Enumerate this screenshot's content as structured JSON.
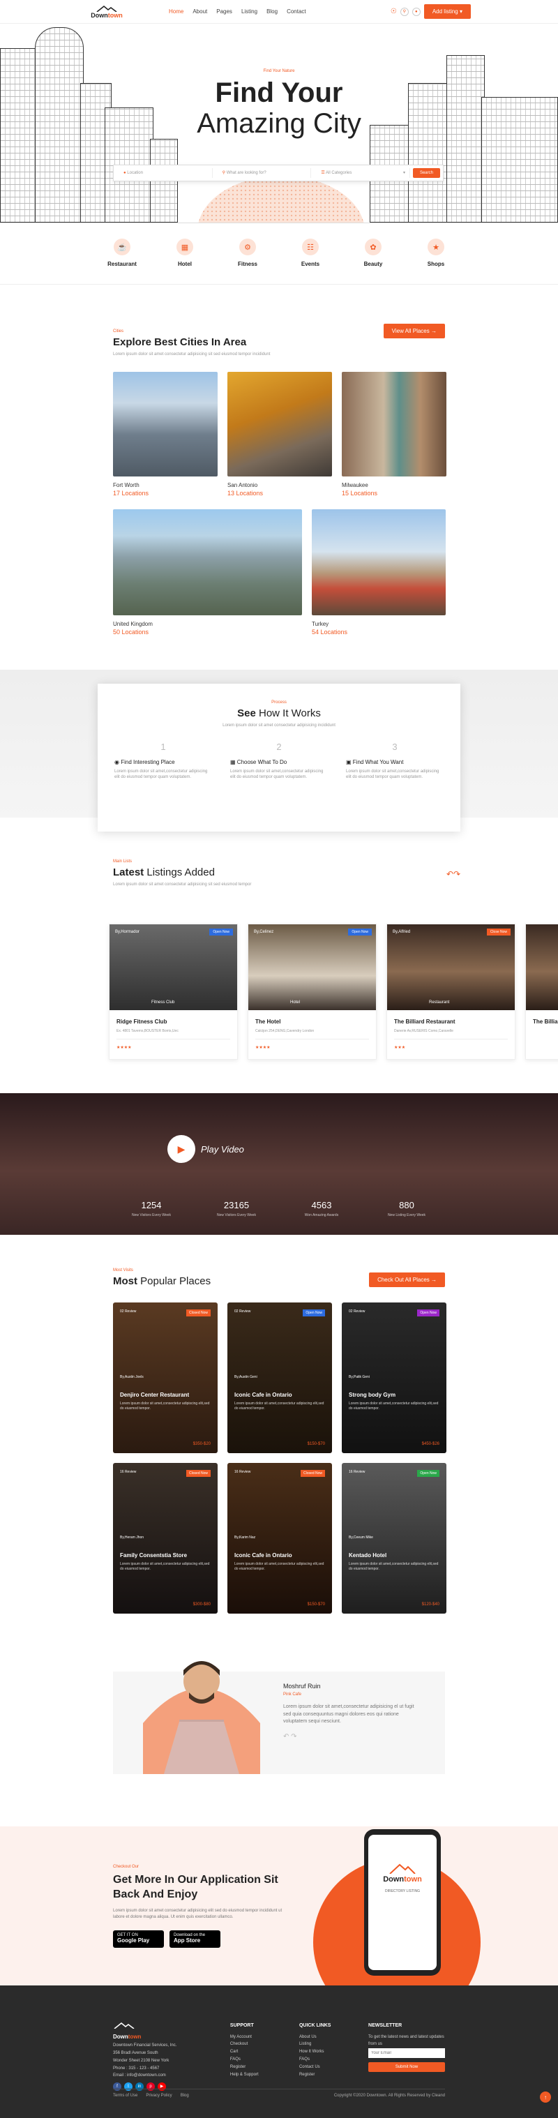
{
  "brand": {
    "name_a": "Down",
    "name_b": "town"
  },
  "nav": [
    "Home",
    "About",
    "Pages",
    "Listing",
    "Blog",
    "Contact"
  ],
  "header": {
    "add_listing": "Add listing"
  },
  "hero": {
    "sub": "Find Your Nature",
    "title": "Find Your",
    "title2": "Amazing City",
    "search": {
      "location": "Location",
      "what": "What are looking for?",
      "category": "All Categories",
      "btn": "Search"
    }
  },
  "categories": [
    "Restaurant",
    "Hotel",
    "Fitness",
    "Events",
    "Beauty",
    "Shops"
  ],
  "cities": {
    "sub": "Cities",
    "title": "Explore Best Cities In Area",
    "desc": "Lorem ipsum dolor sit amet consectetur adipisicing sit sed eiusmod tempor incididunt",
    "btn": "View All Places",
    "items": [
      {
        "name": "Fort Worth",
        "count": "17 Locations"
      },
      {
        "name": "San Antonio",
        "count": "13 Locations"
      },
      {
        "name": "Milwaukee",
        "count": "15 Locations"
      },
      {
        "name": "United Kingdom",
        "count": "50 Locations"
      },
      {
        "name": "Turkey",
        "count": "54 Locations"
      }
    ]
  },
  "how": {
    "sub": "Process",
    "title_b": "See",
    "title": "How It Works",
    "desc": "Lorem ipsum dolor sit amet consectetur adipisicing incididunt",
    "steps": [
      {
        "n": "1",
        "t": "Find Interesting Place",
        "d": "Lorem ipsum dolor sit amet,consectetur adipiscing elit do eiusmod tempor quam voluptatem."
      },
      {
        "n": "2",
        "t": "Choose What To Do",
        "d": "Lorem ipsum dolor sit amet,consectetur adipiscing elit do eiusmod tempor quam voluptatem."
      },
      {
        "n": "3",
        "t": "Find What You Want",
        "d": "Lorem ipsum dolor sit amet,consectetur adipiscing elit do eiusmod tempor quam voluptatem."
      }
    ]
  },
  "latest": {
    "sub": "Main Lists",
    "title_b": "Latest",
    "title": "Listings Added",
    "desc": "Lorem ipsum dolor sit amet consectetur adipisicing sit sed eiusmod tempor",
    "items": [
      {
        "by": "By,Hormador",
        "status": "Open Now",
        "cat": "Fitness Club",
        "name": "Ridge Fitness Club",
        "addr": "Ex. 4801 Taverns,BOUSTER Borris,Uec"
      },
      {
        "by": "By,Celinez",
        "status": "Open Now",
        "cat": "Hotel",
        "name": "The Hotel",
        "addr": "Calcijon 254,DENG,Cavendry London"
      },
      {
        "by": "By,Alfried",
        "status": "Close Now",
        "cat": "Restaurant",
        "name": "The Billiard Restaurant",
        "addr": "Danerie Av,RUSERIS Como,Caravelle"
      },
      {
        "by": "",
        "status": "",
        "cat": "",
        "name": "The Billia",
        "addr": ""
      }
    ]
  },
  "video": {
    "label": "Play Video",
    "stats": [
      {
        "v": "1254",
        "l": "New Visitors Every Week"
      },
      {
        "v": "23165",
        "l": "New Visitors Every Week"
      },
      {
        "v": "4563",
        "l": "Won Amazing Awards"
      },
      {
        "v": "880",
        "l": "New Listing Every Week"
      }
    ]
  },
  "popular": {
    "sub": "Most Visits",
    "title_b": "Most",
    "title": "Popular Places",
    "btn": "Check Out All Places",
    "items": [
      {
        "rev": "02 Review",
        "badge": "Closed Now",
        "author": "By,Austin Joels",
        "addr": "Stuggs Gar Comerdelle",
        "name": "Denjiro Center Restaurant",
        "price": "$350-$20"
      },
      {
        "rev": "02 Review",
        "badge": "Open Now",
        "author": "By,Austin Geni",
        "addr": "All Bellen,Square Plaza,Lanka",
        "name": "Iconic Cafe in Ontario",
        "price": "$150-$70"
      },
      {
        "rev": "02 Review",
        "badge": "Open Now",
        "author": "By,Patik Geni",
        "addr": "Es 56 Montgomery,BOSTON",
        "name": "Strong body Gym",
        "price": "$450-$26"
      },
      {
        "rev": "16 Review",
        "badge": "Closed Now",
        "author": "By,Heram Jhon",
        "addr": "356 Bradley Lane Nonia,US",
        "name": "Family Consentstia Store",
        "price": "$300-$80"
      },
      {
        "rev": "16 Review",
        "badge": "Closed Now",
        "author": "By,Karim Naz",
        "addr": "All Bleek Square Plaza,Indu",
        "name": "Iconic Cafe in Ontario",
        "price": "$150-$70"
      },
      {
        "rev": "16 Review",
        "badge": "Open Now",
        "author": "By,Ceeum Mike",
        "addr": "Es 30 Montgomery,KIBON",
        "name": "Kentado Hotel",
        "price": "$120-$40"
      }
    ],
    "desc": "Lorem ipsum dolor sit amet,consectetur adipiscing elit,sed do eiusmod tempor."
  },
  "testimonial": {
    "name": "Moshruf Ruin",
    "role": "Pink Cafe",
    "text": "Lorem ipsum dolor sit amet,consectetur adipisicing el ut fugit sed quia consequuntus magni dolores eos qui ratione voluptatem sequi nesciunt."
  },
  "app": {
    "sub": "Checkout Our",
    "title": "Get More In Our Application Sit Back And Enjoy",
    "desc": "Lorem ipsum dolor sit amet consectetur adipisicing elit sed do eiusmod tempor incididunt ut labore et dolore magna aliqua. Ut enim quis exercitation ullamco.",
    "google_sm": "GET IT ON",
    "google": "Google Play",
    "apple_sm": "Download on the",
    "apple": "App Store",
    "screen_text": "DIRECTORY LISTING"
  },
  "footer": {
    "addr1": "Downtown Financial Services, Inc.",
    "addr2": "356 Bradl Avenue South",
    "addr3": "Wonder Sheet 2108 New York",
    "phone": "Phone : 315 - 123 - 4567",
    "email": "Email : info@downtown.com",
    "support": {
      "title": "SUPPORT",
      "items": [
        "My Account",
        "Checkout",
        "Cart",
        "FAQs",
        "Register",
        "Help & Support"
      ]
    },
    "quick": {
      "title": "QUICK LINKS",
      "items": [
        "About Us",
        "Listing",
        "How It Works",
        "FAQs",
        "Contact Us",
        "Register"
      ]
    },
    "news": {
      "title": "NEWSLETTER",
      "desc": "To get the latest news and latest updates from us",
      "placeholder": "Your Email",
      "btn": "Submit Now"
    },
    "links": [
      "Terms of Use",
      "Privacy Policy",
      "Blog"
    ],
    "copy": "Copyright ©2020 Downtown. All Rights Reserved by Cleand"
  }
}
